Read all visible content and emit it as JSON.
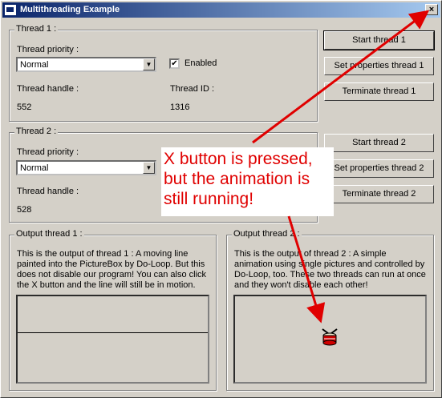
{
  "window": {
    "title": "Multithreading Example",
    "close_label": "×"
  },
  "thread1": {
    "group_title": "Thread 1 :",
    "priority_label": "Thread priority :",
    "priority_value": "Normal",
    "enabled_label": "Enabled",
    "enabled_checked": "✔",
    "handle_label": "Thread handle :",
    "handle_value": "552",
    "id_label": "Thread ID :",
    "id_value": "1316",
    "start_button": "Start thread 1",
    "set_button": "Set properties thread 1",
    "terminate_button": "Terminate thread 1"
  },
  "thread2": {
    "group_title": "Thread 2 :",
    "priority_label": "Thread priority :",
    "priority_value": "Normal",
    "handle_label": "Thread handle :",
    "handle_value": "528",
    "start_button": "Start thread 2",
    "set_button": "Set properties thread 2",
    "terminate_button": "Terminate thread 2"
  },
  "output1": {
    "group_title": "Output thread 1 :",
    "text": "This is the output of thread 1 : A moving line painted into the PictureBox by Do-Loop. But this does not disable our program! You can also click the X button and the line will still be in motion."
  },
  "output2": {
    "group_title": "Output thread 2 :",
    "text": "This is the output of thread 2 : A simple animation using single pictures and controlled by Do-Loop, too. These two threads can run at once and they won't disable each other!"
  },
  "annotation": {
    "line1": "X button is pressed,",
    "line2": "but the animation is",
    "line3": "still running!",
    "color": "#e00000"
  }
}
